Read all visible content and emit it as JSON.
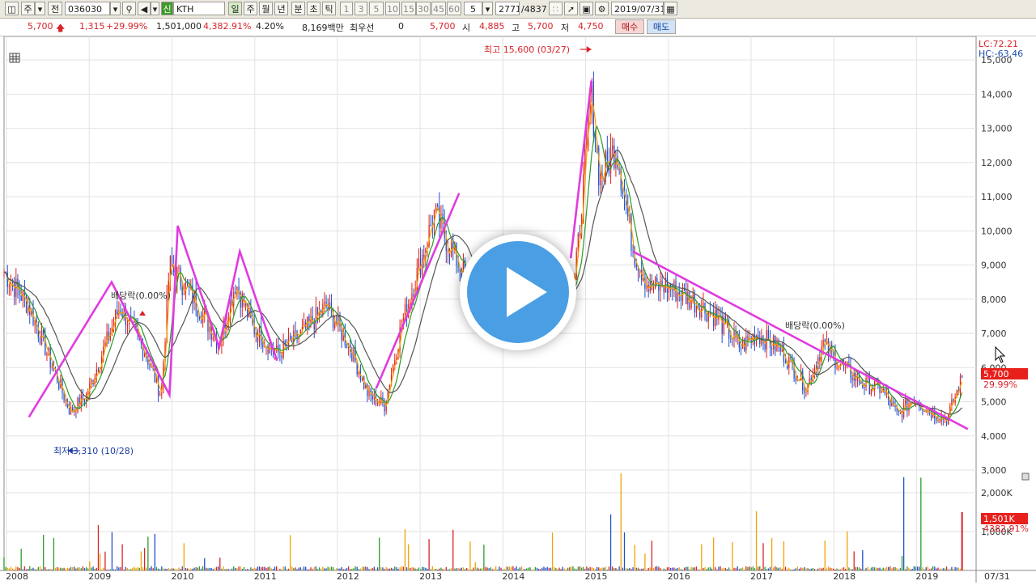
{
  "toolbar": {
    "menu_icon": "panel-layout-icon",
    "market_type": "주",
    "prev_label": "전",
    "stock_code": "036030",
    "stock_name": "KTH",
    "credit_label": "신",
    "periods": [
      "일",
      "주",
      "월",
      "년",
      "분",
      "초",
      "틱"
    ],
    "active_period": "일",
    "intervals": [
      "1",
      "3",
      "5",
      "10",
      "15",
      "30",
      "45",
      "60"
    ],
    "interval_value": "5",
    "position": "2771",
    "total": "/4837",
    "date": "2019/07/31"
  },
  "quote": {
    "price": "5,700",
    "change": "1,315",
    "change_pct": "+29.99%",
    "volume": "1,501,000",
    "volume_pct": "4,382.91%",
    "turnover": "4.20%",
    "amount": "8,169백만",
    "preferred_label": "최우선",
    "preferred_value": "0",
    "ask": "5,700",
    "open_label": "시",
    "open": "4,885",
    "high_label": "고",
    "high": "5,700",
    "low_label": "저",
    "low": "4,750",
    "buy_label": "매수",
    "sell_label": "매도"
  },
  "chart": {
    "lc": "LC:72.21",
    "hc": "HC:-63.46",
    "price_ticks": [
      "15,000",
      "14,000",
      "13,000",
      "12,000",
      "11,000",
      "10,000",
      "9,000",
      "8,000",
      "7,000",
      "6,000",
      "5,000",
      "4,000",
      "3,000"
    ],
    "year_ticks": [
      "2008",
      "2009",
      "2010",
      "2011",
      "2012",
      "2013",
      "2014",
      "2015",
      "2016",
      "2017",
      "2018",
      "2019",
      "07/31"
    ],
    "volume_ticks": [
      "2,000K",
      "1,000K"
    ],
    "high_annotation": "최고 15,600 (03/27)",
    "low_annotation": "최저 3,310 (10/28)",
    "dividend_1": "배당락(0.00%)",
    "dividend_2": "배당락(0.00%)",
    "last_price": "5,700",
    "last_change": "29.99%",
    "last_volume": "1,501K",
    "last_volume_pct": "4382.91%"
  },
  "chart_data": {
    "type": "line",
    "title": "",
    "xlabel": "",
    "ylabel": "",
    "ylim": [
      3000,
      15500
    ],
    "x_start": "2008",
    "x_end": "07/31",
    "series": [
      {
        "values": [
          [
            2008.0,
            8800
          ],
          [
            2008.3,
            7800
          ],
          [
            2008.8,
            4700
          ],
          [
            2009.0,
            5200
          ],
          [
            2009.4,
            7800
          ],
          [
            2009.7,
            6500
          ],
          [
            2009.9,
            5200
          ],
          [
            2010.0,
            9000
          ],
          [
            2010.3,
            8000
          ],
          [
            2010.6,
            6700
          ],
          [
            2010.8,
            8500
          ],
          [
            2011.0,
            7200
          ],
          [
            2011.3,
            6400
          ],
          [
            2011.6,
            7000
          ],
          [
            2011.9,
            7800
          ],
          [
            2012.2,
            6500
          ],
          [
            2012.4,
            5200
          ],
          [
            2012.6,
            4900
          ],
          [
            2012.8,
            7200
          ],
          [
            2013.0,
            8800
          ],
          [
            2013.2,
            10500
          ],
          [
            2013.5,
            9000
          ],
          [
            2013.7,
            8200
          ],
          [
            2014.0,
            8000
          ],
          [
            2014.5,
            8200
          ],
          [
            2014.9,
            8500
          ],
          [
            2015.1,
            14000
          ],
          [
            2015.2,
            11500
          ],
          [
            2015.4,
            12500
          ],
          [
            2015.6,
            9500
          ],
          [
            2015.8,
            8300
          ],
          [
            2016.0,
            8400
          ],
          [
            2016.3,
            8000
          ],
          [
            2016.6,
            7500
          ],
          [
            2016.9,
            6600
          ],
          [
            2017.1,
            7000
          ],
          [
            2017.4,
            6500
          ],
          [
            2017.7,
            5400
          ],
          [
            2017.9,
            6700
          ],
          [
            2018.1,
            6100
          ],
          [
            2018.4,
            5500
          ],
          [
            2018.6,
            5400
          ],
          [
            2018.8,
            4600
          ],
          [
            2019.0,
            5100
          ],
          [
            2019.2,
            4700
          ],
          [
            2019.4,
            4500
          ],
          [
            2019.58,
            5700
          ]
        ]
      }
    ],
    "trendlines": [
      [
        [
          2008.3,
          4550
        ],
        [
          2009.3,
          8500
        ],
        [
          2010.0,
          5200
        ],
        [
          2010.1,
          10150
        ],
        [
          2010.6,
          6600
        ],
        [
          2010.85,
          9400
        ],
        [
          2011.3,
          6200
        ]
      ],
      [
        [
          2012.5,
          5400
        ],
        [
          2013.5,
          11100
        ]
      ],
      [
        [
          2014.85,
          9200
        ],
        [
          2015.1,
          14400
        ]
      ],
      [
        [
          2015.6,
          9400
        ],
        [
          2019.65,
          4200
        ]
      ]
    ],
    "annotations": {
      "high": {
        "label": "최고 15,600 (03/27)",
        "x": 2015.1,
        "y": 15600
      },
      "low": {
        "label": "최저 3,310 (10/28)",
        "x": 2008.8,
        "y": 3310
      }
    },
    "volume": {
      "ylim": [
        0,
        2500
      ],
      "unit": "K",
      "last": 1501
    },
    "grid": true,
    "legend": "none"
  }
}
